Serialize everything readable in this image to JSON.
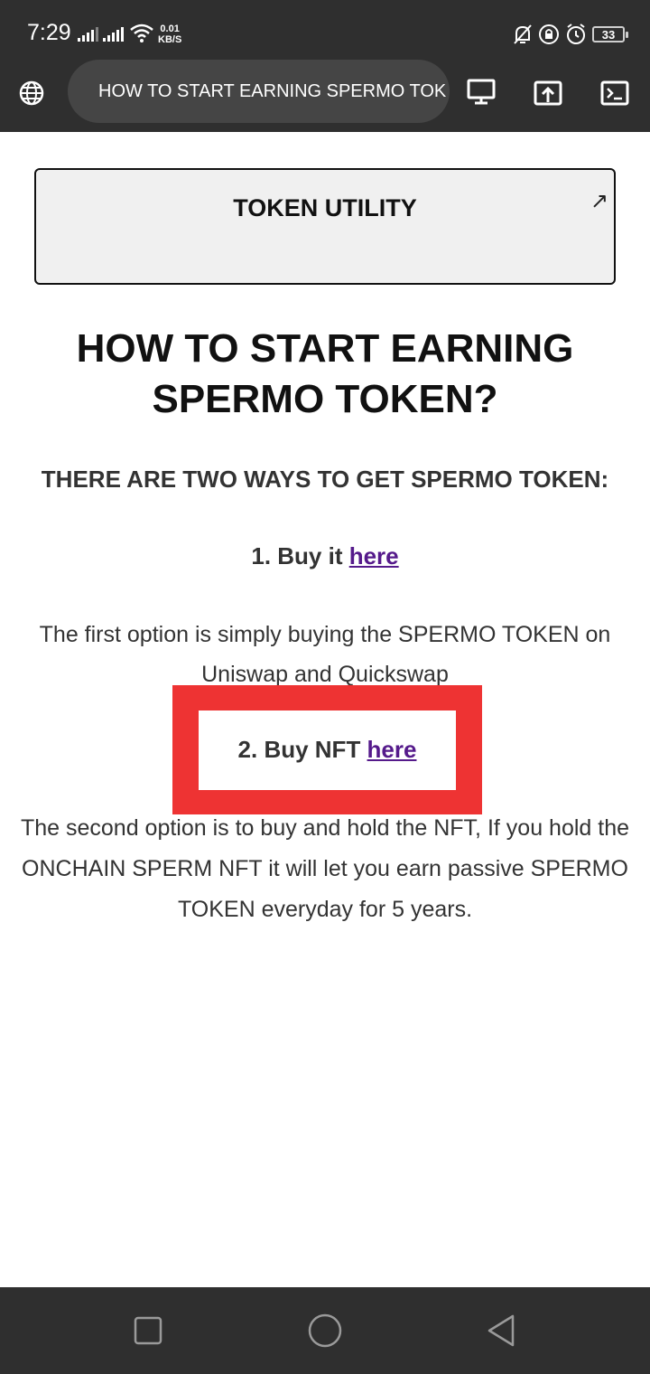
{
  "status_bar": {
    "time": "7:29",
    "net_speed_value": "0.01",
    "net_speed_unit": "KB/S",
    "battery": "33"
  },
  "browser": {
    "url_title": "HOW TO START EARNING SPERMO TOK",
    "icons": [
      "globe-icon",
      "desktop-icon",
      "share-icon",
      "terminal-icon"
    ]
  },
  "page": {
    "utility_title": "TOKEN UTILITY",
    "heading": "HOW TO START EARNING SPERMO TOKEN?",
    "subheading": "THERE ARE TWO WAYS TO GET SPERMO TOKEN:",
    "option1_prefix": "1. Buy it ",
    "option1_link": "here",
    "para1": "The first option is simply buying the SPERMO TOKEN on Uniswap and Quickswap",
    "option2_prefix": "2. Buy NFT ",
    "option2_link": "here",
    "para2": "The second option is to buy and hold the NFT, If you hold the ONCHAIN SPERM NFT it will let you earn passive SPERMO TOKEN everyday for 5 years."
  },
  "colors": {
    "bar_bg": "#2f2f2f",
    "pill_bg": "#454545",
    "highlight": "#ee3333",
    "link": "#551a8b"
  }
}
